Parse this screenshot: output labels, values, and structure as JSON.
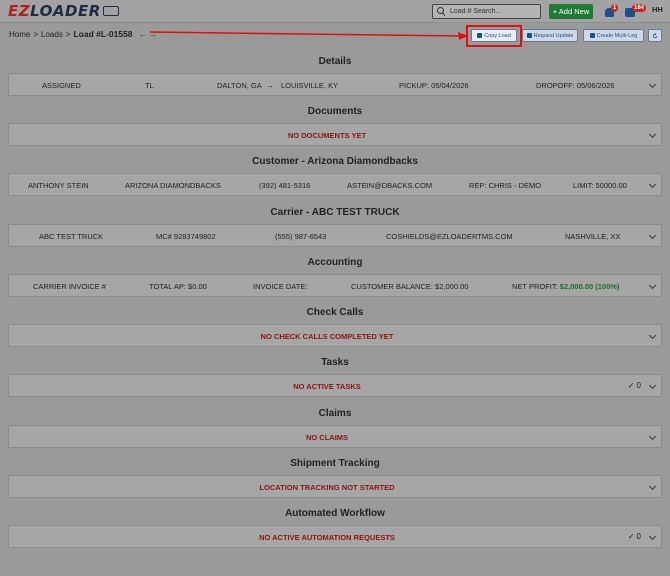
{
  "header": {
    "logo_prefix": "EZ",
    "logo_rest": "LOADER",
    "search_placeholder": "Load # Search...",
    "add_new_label": "+ Add New",
    "notification_count": "1",
    "message_count": "184",
    "user_initials": "HH"
  },
  "breadcrumb": {
    "home": "Home",
    "sep1": ">",
    "loads": "Loads",
    "sep2": ">",
    "current": "Load #L-01558",
    "nav_arrows": "← →"
  },
  "actions": {
    "copy_load": "Copy Load",
    "request_update": "Request Update",
    "create_multi_leg": "Create Multi-Leg"
  },
  "sections": {
    "details": {
      "title": "Details",
      "status": "ASSIGNED",
      "mode": "TL",
      "origin": "DALTON, GA",
      "arrow": "→",
      "destination": "LOUISVILLE, KY",
      "pickup": "PICKUP: 05/04/2026",
      "dropoff": "DROPOFF: 05/06/2026"
    },
    "documents": {
      "title": "Documents",
      "empty": "NO DOCUMENTS YET"
    },
    "customer": {
      "title": "Customer - Arizona Diamondbacks",
      "contact": "ANTHONY STEIN",
      "company": "ARIZONA DIAMONDBACKS",
      "phone": "(392) 481-5316",
      "email": "ASTEIN@DBACKS.COM",
      "rep": "REP: CHRIS - DEMO",
      "limit": "LIMIT: 50000.00"
    },
    "carrier": {
      "title": "Carrier - ABC TEST TRUCK",
      "name": "ABC TEST TRUCK",
      "mc": "MC# 9283749802",
      "phone": "(555) 987-6543",
      "email": "COSHIELDS@EZLOADERTMS.COM",
      "location": "NASHVILLE, XX"
    },
    "accounting": {
      "title": "Accounting",
      "carrier_invoice": "CARRIER INVOICE #",
      "total_ap": "TOTAL AP: $0.00",
      "invoice_date": "INVOICE DATE:",
      "customer_balance": "CUSTOMER BALANCE: $2,000.00",
      "net_profit_label": "NET PROFIT:",
      "net_profit_value": "$2,000.00 (100%)"
    },
    "check_calls": {
      "title": "Check Calls",
      "empty": "NO CHECK CALLS COMPLETED YET"
    },
    "tasks": {
      "title": "Tasks",
      "empty": "NO ACTIVE TASKS",
      "count": "0"
    },
    "claims": {
      "title": "Claims",
      "empty": "NO CLAIMS"
    },
    "shipment_tracking": {
      "title": "Shipment Tracking",
      "empty": "LOCATION TRACKING NOT STARTED"
    },
    "automated_workflow": {
      "title": "Automated Workflow",
      "empty": "NO ACTIVE AUTOMATION REQUESTS",
      "count": "0"
    }
  },
  "colors": {
    "accent_red": "#e01010",
    "empty_text": "#8b1414",
    "profit_green": "#1e6b2c",
    "primary_blue": "#1d4f8f"
  }
}
